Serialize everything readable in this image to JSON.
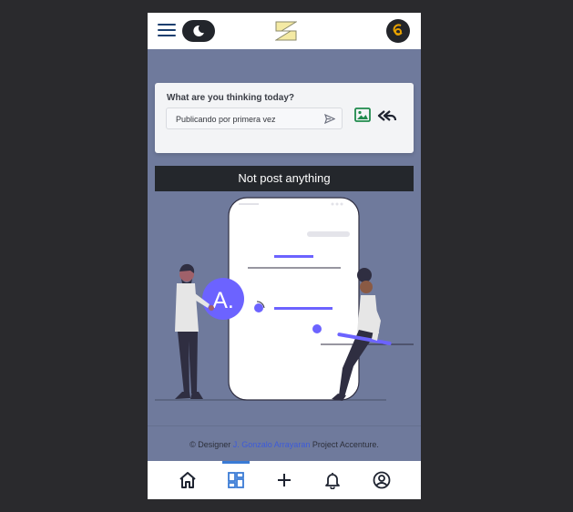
{
  "header": {
    "menu_icon": "hamburger-icon",
    "theme_icon": "moon-icon",
    "logo_icon": "app-logo",
    "avatar_icon": "user-avatar"
  },
  "composer": {
    "prompt_label": "What are you thinking today?",
    "input_value": "Publicando por primera vez",
    "send_icon": "send-icon",
    "image_icon": "image-upload-icon",
    "reply_icon": "reply-all-icon"
  },
  "feed": {
    "empty_message": "Not post anything",
    "illustration_badge": "A."
  },
  "footer": {
    "prefix": "© Designer ",
    "author": "J. Gonzalo Arrayaran",
    "suffix": " Project Accenture."
  },
  "bottom_nav": {
    "items": [
      {
        "name": "home",
        "icon": "home-icon"
      },
      {
        "name": "dashboard",
        "icon": "dashboard-icon",
        "active": true
      },
      {
        "name": "add",
        "icon": "plus-icon"
      },
      {
        "name": "notifications",
        "icon": "bell-icon"
      },
      {
        "name": "profile",
        "icon": "account-icon"
      }
    ]
  },
  "colors": {
    "background": "#6f7a9c",
    "accent": "#6c63ff",
    "active_tab": "#3a7bd5",
    "banner": "#24272c"
  }
}
